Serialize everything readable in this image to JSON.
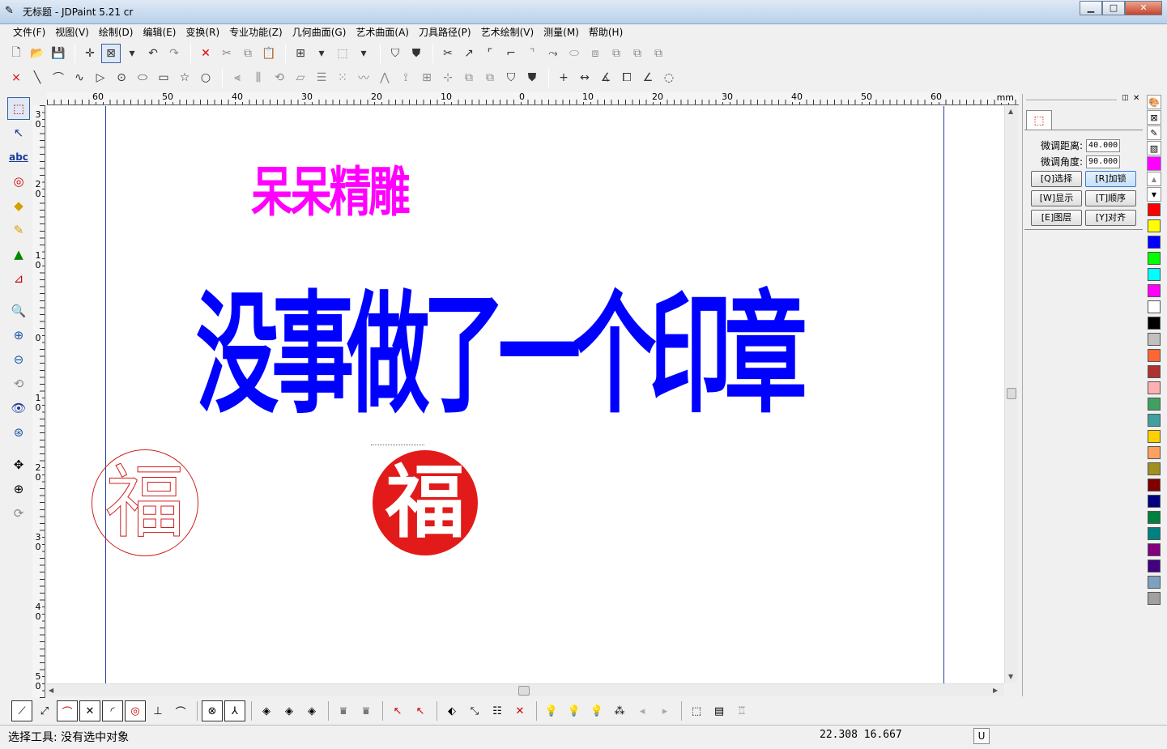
{
  "window": {
    "title": "无标题 - JDPaint 5.21 cr",
    "minimize": "▁",
    "maximize": "□",
    "close": "✕"
  },
  "menu": [
    {
      "label": "文件(F)"
    },
    {
      "label": "视图(V)"
    },
    {
      "label": "绘制(D)"
    },
    {
      "label": "编辑(E)"
    },
    {
      "label": "变换(R)"
    },
    {
      "label": "专业功能(Z)"
    },
    {
      "label": "几何曲面(G)"
    },
    {
      "label": "艺术曲面(A)"
    },
    {
      "label": "刀具路径(P)"
    },
    {
      "label": "艺术绘制(V)"
    },
    {
      "label": "测量(M)"
    },
    {
      "label": "帮助(H)"
    }
  ],
  "ruler": {
    "unit": "mm",
    "h_labels": [
      "60",
      "50",
      "40",
      "30",
      "20",
      "10",
      "0",
      "10",
      "20",
      "30",
      "40",
      "50",
      "60"
    ],
    "v_labels": [
      "3\n0",
      "2\n0",
      "1\n0",
      "0",
      "1\n0",
      "2\n0",
      "3\n0",
      "4\n0",
      "5\n0"
    ]
  },
  "canvas": {
    "text1": {
      "text": "呆呆精雕",
      "color": "#ff00ff"
    },
    "text2": {
      "text": "没事做了一个印章",
      "color": "#0000ff"
    },
    "stamp_char": "福",
    "stamp_color": "#e21a1a"
  },
  "panel": {
    "fine_distance_label": "微调距离:",
    "fine_distance_value": "40.000",
    "fine_angle_label": "微调角度:",
    "fine_angle_value": "90.000",
    "buttons": [
      {
        "label": "[Q]选择"
      },
      {
        "label": "[R]加锁"
      },
      {
        "label": "[W]显示"
      },
      {
        "label": "[T]顺序"
      },
      {
        "label": "[E]图层"
      },
      {
        "label": "[Y]对齐"
      }
    ]
  },
  "palette": [
    "#ff0000",
    "#ffff00",
    "#0000ff",
    "#00ff00",
    "#00ffff",
    "#ff00ff",
    "#ffffff",
    "#000000",
    "#c0c0c0",
    "#ff6633",
    "#b03030",
    "#ffb0b0",
    "#40a060",
    "#40a0a0",
    "#ffd000",
    "#ffa060",
    "#a09020",
    "#800000",
    "#000080",
    "#008040",
    "#008080",
    "#800080",
    "#400080",
    "#80a0c0",
    "#a0a0a0"
  ],
  "status": {
    "text": "选择工具: 没有选中对象",
    "coords": "22.308  16.667",
    "mode": "U"
  }
}
